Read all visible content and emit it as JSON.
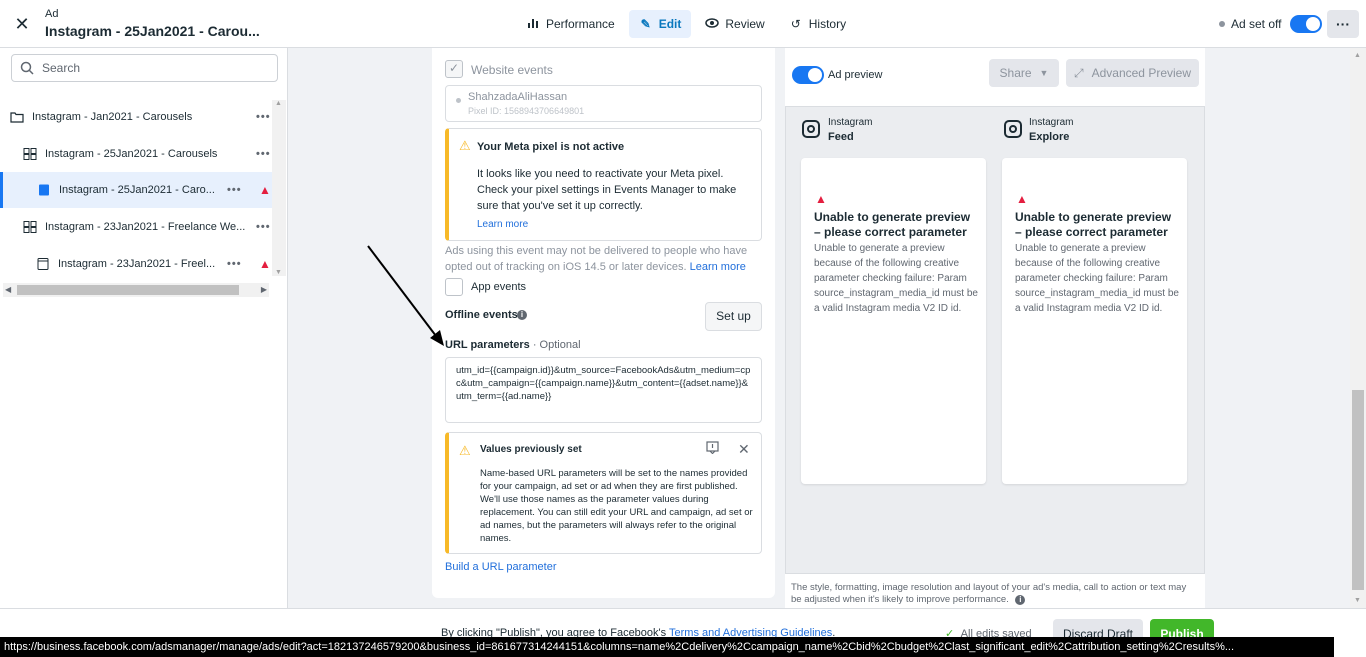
{
  "header": {
    "close_label": "✕",
    "small_label": "Ad",
    "title": "Instagram - 25Jan2021 - Carou...",
    "nav": [
      {
        "label": "Performance",
        "icon": "bar-chart-icon"
      },
      {
        "label": "Edit",
        "icon": "pencil-icon",
        "active": true
      },
      {
        "label": "Review",
        "icon": "eye-icon"
      },
      {
        "label": "History",
        "icon": "history-icon"
      }
    ],
    "adset_status": "Ad set off",
    "more": "···"
  },
  "sidebar": {
    "search_placeholder": "Search",
    "items": [
      {
        "label": "Instagram - Jan2021 - Carousels",
        "icon": "folder-icon"
      },
      {
        "label": "Instagram - 25Jan2021 - Carousels",
        "icon": "grid-icon"
      },
      {
        "label": "Instagram - 25Jan2021 - Caro...",
        "icon": "ad-icon",
        "selected": true
      },
      {
        "label": "Instagram - 23Jan2021 - Freelance We...",
        "icon": "grid-icon"
      },
      {
        "label": "Instagram - 23Jan2021 - Freel...",
        "icon": "ad-icon"
      }
    ],
    "dots": "•••"
  },
  "tracking": {
    "website_events": "Website events",
    "pixel_name": "ShahzadaAliHassan",
    "pixel_id": "Pixel ID: 1568943706649801",
    "pixel_warning_title": "Your Meta pixel is not active",
    "pixel_warning_body": "It looks like you need to reactivate your Meta pixel. Check your pixel settings in Events Manager to make sure that you've set it up correctly.",
    "learn_more": "Learn more",
    "ios_note": "Ads using this event may not be delivered to people who have opted out of tracking on iOS 14.5 or later devices.",
    "ios_learn_more": "Learn more",
    "app_events": "App events",
    "offline_events": "Offline events",
    "info": "i",
    "setup": "Set up",
    "url_params_label": "URL parameters",
    "url_params_optional": " · Optional",
    "url_params_value": "utm_id={{campaign.id}}&utm_source=FacebookAds&utm_medium=cpc&utm_campaign={{campaign.name}}&utm_content={{adset.name}}&utm_term={{ad.name}}",
    "values_title": "Values previously set",
    "values_body": "Name-based URL parameters will be set to the names provided for your campaign, ad set or ad when they are first published. We'll use those names as the parameter values during replacement. You can still edit your URL and campaign, ad set or ad names, but the parameters will always refer to the original names.",
    "build_url": "Build a URL parameter"
  },
  "preview": {
    "toggle_label": "Ad preview",
    "share": "Share",
    "advanced": "Advanced Preview",
    "placements": [
      {
        "platform": "Instagram",
        "placement": "Feed"
      },
      {
        "platform": "Instagram",
        "placement": "Explore"
      }
    ],
    "error_title": "Unable to generate preview – please correct parameter",
    "error_body": "Unable to generate a preview because of the following creative parameter checking failure: Param source_instagram_media_id must be a valid Instagram media V2 ID id.",
    "disclaimer": "The style, formatting, image resolution and layout of your ad's media, call to action or text may be adjusted when it's likely to improve performance."
  },
  "footer": {
    "agree_prefix": "By clicking \"Publish\", you agree to Facebook's ",
    "agree_link": "Terms and Advertising Guidelines",
    "agree_suffix": ".",
    "saved": "All edits saved",
    "discard": "Discard Draft",
    "publish": "Publish"
  },
  "status_url": "https://business.facebook.com/adsmanager/manage/ads/edit?act=182137246579200&business_id=861677314244151&columns=name%2Cdelivery%2Ccampaign_name%2Cbid%2Cbudget%2Clast_significant_edit%2Cattribution_setting%2Cresults%..."
}
